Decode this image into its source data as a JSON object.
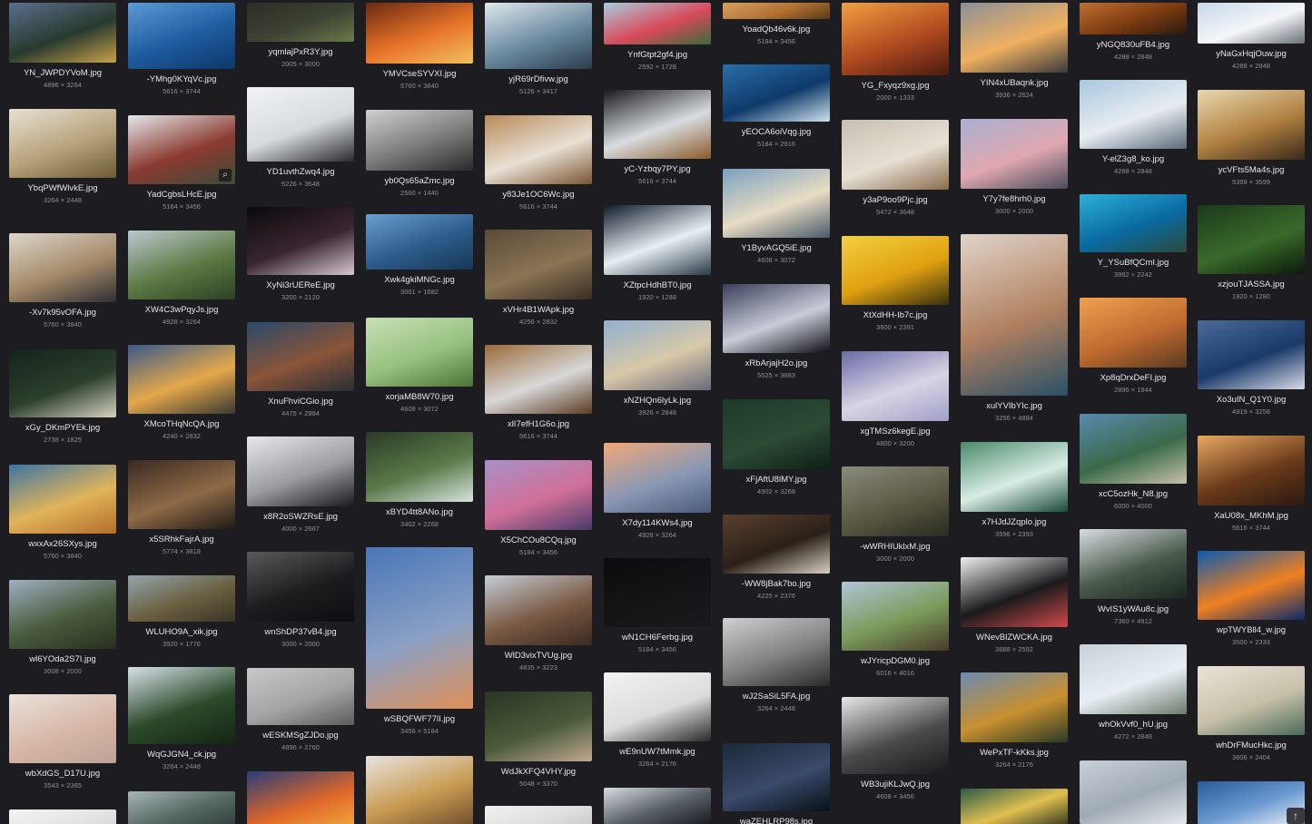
{
  "gallery": {
    "hovered_zoom_icon": "magnifier-icon",
    "scroll_top_icon": "arrow-up-icon",
    "columns": [
      [
        {
          "name": "YN_JWPDYVoM.jpg",
          "dims": "4896 × 3264",
          "colors": [
            "#5a6f8c",
            "#283a2e",
            "#c8a24a"
          ]
        },
        {
          "name": "YbqPWfWlvkE.jpg",
          "dims": "3264 × 2448",
          "colors": [
            "#e7e1d3",
            "#b6a27a",
            "#6b5a36"
          ]
        },
        {
          "name": "-Xv7k95vOFA.jpg",
          "dims": "5760 × 3840",
          "colors": [
            "#dcd6cc",
            "#a48a68",
            "#2e2e34"
          ]
        },
        {
          "name": "xGy_DKmPYEk.jpg",
          "dims": "2738 × 1825",
          "colors": [
            "#14231c",
            "#2c3f2c",
            "#d8d2c2"
          ]
        },
        {
          "name": "wxxAx26SXys.jpg",
          "dims": "5760 × 3840",
          "colors": [
            "#3f74a4",
            "#e0b45a",
            "#b36c2a"
          ]
        },
        {
          "name": "wl6YOda2S7I.jpg",
          "dims": "3008 × 2000",
          "colors": [
            "#9fb0c2",
            "#4a5a3c",
            "#283120"
          ]
        },
        {
          "name": "wbXdGS_D17U.jpg",
          "dims": "3543 × 2365",
          "colors": [
            "#e8e2dc",
            "#d7b7a6",
            "#bca296"
          ]
        },
        {
          "name": "",
          "dims": "",
          "colors": [
            "#f2f2f2",
            "#e4e4e4",
            "#d0d0d0"
          ]
        }
      ],
      [
        {
          "name": "-YMhg0KYqVc.jpg",
          "dims": "5616 × 3744",
          "colors": [
            "#5b9ad8",
            "#1e5b9e",
            "#0d3668"
          ]
        },
        {
          "name": "YadCgbsLHcE.jpg",
          "dims": "5184 × 3456",
          "colors": [
            "#e4e8ec",
            "#8b3a30",
            "#3c4c3a"
          ]
        },
        {
          "name": "XW4C3wPqyJs.jpg",
          "dims": "4928 × 3264",
          "colors": [
            "#bdc7cf",
            "#5c7a44",
            "#2d4024"
          ]
        },
        {
          "name": "XMcoTHqNcQA.jpg",
          "dims": "4240 × 2832",
          "colors": [
            "#395a8c",
            "#e5a84a",
            "#3a3834"
          ]
        },
        {
          "name": "x5SRhkFajrA.jpg",
          "dims": "5774 × 3818",
          "colors": [
            "#3a2a22",
            "#8e6a46",
            "#201a16"
          ]
        },
        {
          "name": "WLUHO9A_xik.jpg",
          "dims": "3920 × 1776",
          "colors": [
            "#93a4ac",
            "#6a6040",
            "#3a3426"
          ]
        },
        {
          "name": "WqGJGN4_ck.jpg",
          "dims": "3264 × 2448",
          "colors": [
            "#d8e2e8",
            "#2c4a2a",
            "#142414"
          ]
        },
        {
          "name": "",
          "dims": "",
          "colors": [
            "#a8b4b8",
            "#566a62",
            "#2e3c3a"
          ]
        }
      ],
      [
        {
          "name": "yqmlajPxR3Y.jpg",
          "dims": "2005 × 3000",
          "colors": [
            "#2b2d26",
            "#3e4434",
            "#6a7a4a"
          ]
        },
        {
          "name": "YD1uvthZwq4.jpg",
          "dims": "5226 × 3648",
          "colors": [
            "#f2f4f6",
            "#d6dade",
            "#2a2a2c"
          ]
        },
        {
          "name": "XyNi3rUEReE.jpg",
          "dims": "3200 × 2120",
          "colors": [
            "#0a0a0c",
            "#3a2630",
            "#d8c8d0"
          ]
        },
        {
          "name": "XnuFhviCGio.jpg",
          "dims": "4475 × 2984",
          "colors": [
            "#2a4a6a",
            "#8a5438",
            "#2a2e36"
          ]
        },
        {
          "name": "x8R2oSWZRsE.jpg",
          "dims": "4000 × 2667",
          "colors": [
            "#e8e8ea",
            "#9a9ca0",
            "#1a1a1c"
          ]
        },
        {
          "name": "wnShDP37vB4.jpg",
          "dims": "3000 × 2000",
          "colors": [
            "#5a5a5c",
            "#1c1c1e",
            "#0e0e10"
          ]
        },
        {
          "name": "wESKMSgZJDo.jpg",
          "dims": "4896 × 2760",
          "colors": [
            "#c8c8c8",
            "#a4a4a4",
            "#5c5c5c"
          ]
        },
        {
          "name": "",
          "dims": "",
          "colors": [
            "#2a3c78",
            "#e0682a",
            "#f2b440"
          ]
        }
      ],
      [
        {
          "name": "YMVCseSYVXI.jpg",
          "dims": "5760 × 3840",
          "colors": [
            "#6a2a10",
            "#e8742a",
            "#f0c060"
          ]
        },
        {
          "name": "yb0Qs65aZmc.jpg",
          "dims": "2560 × 1440",
          "colors": [
            "#d0d0d0",
            "#7a7a7a",
            "#2a2a2a"
          ]
        },
        {
          "name": "Xwk4gkiMNGc.jpg",
          "dims": "3061 × 1682",
          "colors": [
            "#6a9ed0",
            "#2c5c8a",
            "#1a3656"
          ]
        },
        {
          "name": "xorjaMB8W70.jpg",
          "dims": "4608 × 3072",
          "colors": [
            "#c8e0b4",
            "#96c080",
            "#4a7434"
          ]
        },
        {
          "name": "xBYD4tt8ANo.jpg",
          "dims": "3402 × 2268",
          "colors": [
            "#2a3a26",
            "#5a7a4a",
            "#d8e4e0"
          ]
        },
        {
          "name": "wSBQFWF77lI.jpg",
          "dims": "3456 × 5184",
          "colors": [
            "#4a76b8",
            "#8aa0c4",
            "#e09058"
          ]
        },
        {
          "name": "",
          "dims": "",
          "colors": [
            "#e8e4de",
            "#c89a52",
            "#6a4a2a"
          ]
        }
      ],
      [
        {
          "name": "yjR69rDfivw.jpg",
          "dims": "5126 × 3417",
          "colors": [
            "#dfe7ec",
            "#6a8aa0",
            "#2a3c4a"
          ]
        },
        {
          "name": "y83Je1OC6Wc.jpg",
          "dims": "5616 × 3744",
          "colors": [
            "#b88a5a",
            "#e8e0d4",
            "#7a5430"
          ]
        },
        {
          "name": "xVHr4B1WApk.jpg",
          "dims": "4256 × 2832",
          "colors": [
            "#5a4a3a",
            "#8a7454",
            "#3a2e24"
          ]
        },
        {
          "name": "xlI7efH1G6o.jpg",
          "dims": "5616 × 3744",
          "colors": [
            "#9a6a3a",
            "#d8d8d8",
            "#5a3c22"
          ]
        },
        {
          "name": "X5ChCOu8CQq.jpg",
          "dims": "5184 × 3456",
          "colors": [
            "#a890c8",
            "#d07098",
            "#4a3a6a"
          ]
        },
        {
          "name": "WlD3vixTVUg.jpg",
          "dims": "4835 × 3223",
          "colors": [
            "#c4ccd6",
            "#7a5a44",
            "#3a2a20"
          ]
        },
        {
          "name": "WdJkXFQ4VHY.jpg",
          "dims": "5048 × 3370",
          "colors": [
            "#2a3424",
            "#4a5a3a",
            "#c0a890"
          ]
        },
        {
          "name": "",
          "dims": "",
          "colors": [
            "#f0f0f0",
            "#e0e0e0",
            "#c8c8c8"
          ]
        }
      ],
      [
        {
          "name": "YnfGtpt2gf4.jpg",
          "dims": "2592 × 1728",
          "colors": [
            "#a8cce0",
            "#d84a5a",
            "#3a6a3a"
          ]
        },
        {
          "name": "yC-Yzbqy7PY.jpg",
          "dims": "5616 × 3744",
          "colors": [
            "#1a1a1c",
            "#d8dce0",
            "#8a5a2a"
          ]
        },
        {
          "name": "XZtpcHdhBT0.jpg",
          "dims": "1920 × 1288",
          "colors": [
            "#0e1a2a",
            "#e8eef2",
            "#2a3a48"
          ]
        },
        {
          "name": "xNZHQn6lyLk.jpg",
          "dims": "3926 × 2848",
          "colors": [
            "#90b0d0",
            "#d8c8a8",
            "#6a6a7a"
          ]
        },
        {
          "name": "X7dy114KWs4.jpg",
          "dims": "4928 × 3264",
          "colors": [
            "#f0a878",
            "#8a98b4",
            "#4a5a78"
          ]
        },
        {
          "name": "wN1CH6Ferbg.jpg",
          "dims": "5184 × 3456",
          "colors": [
            "#0c0c0e",
            "#141416",
            "#1a1a1c"
          ]
        },
        {
          "name": "wE9nUW7tMmk.jpg",
          "dims": "3264 × 2176",
          "colors": [
            "#f2f2f2",
            "#dcdcdc",
            "#2a2a2a"
          ]
        },
        {
          "name": "",
          "dims": "",
          "colors": [
            "#d8dce0",
            "#5a6068",
            "#1a1c20"
          ]
        }
      ],
      [
        {
          "name": "YoadQb46v6k.jpg",
          "dims": "5184 × 3456",
          "colors": [
            "#d8a060",
            "#b07030",
            "#5a3a1a"
          ]
        },
        {
          "name": "yEOCA6oiVqg.jpg",
          "dims": "5184 × 2916",
          "colors": [
            "#2a6ea8",
            "#0e3a6a",
            "#cfe0ec"
          ]
        },
        {
          "name": "Y1ByvAGQ5iE.jpg",
          "dims": "4608 × 3072",
          "colors": [
            "#7aa0c0",
            "#e8dcc4",
            "#4a5a6a"
          ]
        },
        {
          "name": "xRbArjajH2o.jpg",
          "dims": "5525 × 3683",
          "colors": [
            "#3a3e5a",
            "#c8ccd8",
            "#0e0e14"
          ]
        },
        {
          "name": "xFjAftU8lMY.jpg",
          "dims": "4902 × 3268",
          "colors": [
            "#1c3a2a",
            "#2c4a34",
            "#0e2018"
          ]
        },
        {
          "name": "-WW8jBak7bo.jpg",
          "dims": "4225 × 2376",
          "colors": [
            "#5a4030",
            "#2a2018",
            "#d8d0c4"
          ]
        },
        {
          "name": "wJ2SaSiL5FA.jpg",
          "dims": "3264 × 2448",
          "colors": [
            "#d0d0d0",
            "#808080",
            "#2a2a2a"
          ]
        },
        {
          "name": "waZEHLRP98s.jpg",
          "dims": "",
          "colors": [
            "#1a2a3a",
            "#3a4a6a",
            "#0a1018"
          ]
        }
      ],
      [
        {
          "name": "YG_Fxyqz9xg.jpg",
          "dims": "2000 × 1333",
          "colors": [
            "#f0a040",
            "#b04a20",
            "#4a1a10"
          ]
        },
        {
          "name": "y3aP9oo9Pjc.jpg",
          "dims": "5472 × 3648",
          "colors": [
            "#c8c0b0",
            "#e6e0d4",
            "#8a6a4a"
          ]
        },
        {
          "name": "XtXdHH-Ib7c.jpg",
          "dims": "3600 × 2391",
          "colors": [
            "#f0d040",
            "#e0a010",
            "#3a3010"
          ]
        },
        {
          "name": "xgTMSz6kegE.jpg",
          "dims": "4800 × 3200",
          "colors": [
            "#6a6aa8",
            "#d8d4e4",
            "#a0a0c8"
          ]
        },
        {
          "name": "-wWRHIUklxM.jpg",
          "dims": "3000 × 2000",
          "colors": [
            "#8a8a7a",
            "#5a5a44",
            "#2a2a20"
          ]
        },
        {
          "name": "wJYricpDGM0.jpg",
          "dims": "6016 × 4016",
          "colors": [
            "#b0c4d8",
            "#7a9a5a",
            "#4a3a2a"
          ]
        },
        {
          "name": "WB3ujiKLJwQ.jpg",
          "dims": "4608 × 3456",
          "colors": [
            "#e8e8e8",
            "#4a4a4c",
            "#1a1a1c"
          ]
        },
        {
          "name": "",
          "dims": "",
          "colors": [
            "#6a5a4a",
            "#8a7a6a",
            "#3a3a3a"
          ]
        }
      ],
      [
        {
          "name": "YIN4xUBaqnk.jpg",
          "dims": "3936 × 2624",
          "colors": [
            "#8a9098",
            "#f0b060",
            "#3a3a3c"
          ]
        },
        {
          "name": "Y7y7fe8hrh0.jpg",
          "dims": "3000 × 2000",
          "colors": [
            "#a8b0d0",
            "#e0a8b0",
            "#4a4a5a"
          ]
        },
        {
          "name": "xulYVIbYIc.jpg",
          "dims": "3256 × 4884",
          "colors": [
            "#e0d4c8",
            "#b08060",
            "#2a5068"
          ]
        },
        {
          "name": "x7HJdJZqplo.jpg",
          "dims": "3596 × 2393",
          "colors": [
            "#4a8a6a",
            "#d8ece4",
            "#1a4a3a"
          ]
        },
        {
          "name": "WNevBlZWCKA.jpg",
          "dims": "3888 × 2592",
          "colors": [
            "#f0f0f0",
            "#1a1a1c",
            "#d04a4a"
          ]
        },
        {
          "name": "WePxTF-kKks.jpg",
          "dims": "3264 × 2176",
          "colors": [
            "#6a8ab0",
            "#c89030",
            "#2a3a24"
          ]
        },
        {
          "name": "",
          "dims": "",
          "colors": [
            "#2a5a4a",
            "#e0c050",
            "#3a3a20"
          ]
        }
      ],
      [
        {
          "name": "yNGQ830uFB4.jpg",
          "dims": "4288 × 2848",
          "colors": [
            "#c07030",
            "#7a3a10",
            "#2a1810"
          ]
        },
        {
          "name": "Y-elZ3g8_ko.jpg",
          "dims": "4288 × 2848",
          "colors": [
            "#a8c8e0",
            "#e8ecf0",
            "#5a6a78"
          ]
        },
        {
          "name": "Y_YSuBfQCmI.jpg",
          "dims": "3992 × 2242",
          "colors": [
            "#2ab0d8",
            "#0a6aa0",
            "#2a4a3a"
          ]
        },
        {
          "name": "Xp8qDrxDeFI.jpg",
          "dims": "2896 × 1944",
          "colors": [
            "#f0a050",
            "#c06a30",
            "#5a3a20"
          ]
        },
        {
          "name": "xcC5ozHk_N8.jpg",
          "dims": "6000 × 4000",
          "colors": [
            "#5a8ab0",
            "#3a6a4a",
            "#c8c0a8"
          ]
        },
        {
          "name": "WvIS1yWAu8c.jpg",
          "dims": "7360 × 4912",
          "colors": [
            "#d8dce4",
            "#4a5a4a",
            "#1a2420"
          ]
        },
        {
          "name": "whOkVvf0_hU.jpg",
          "dims": "4272 × 2848",
          "colors": [
            "#c8d0d8",
            "#e8eef4",
            "#6a7a6a"
          ]
        },
        {
          "name": "",
          "dims": "",
          "colors": [
            "#c8d0d8",
            "#a0aab4",
            "#e4e8ec"
          ]
        }
      ],
      [
        {
          "name": "yNaGxHqjOuw.jpg",
          "dims": "4288 × 2848",
          "colors": [
            "#c8d8e8",
            "#f4f6f8",
            "#6a7078"
          ]
        },
        {
          "name": "ycVFts5Ma4s.jpg",
          "dims": "5399 × 3599",
          "colors": [
            "#e8d8b0",
            "#b08040",
            "#3a2a1a"
          ]
        },
        {
          "name": "xzjouTJASSA.jpg",
          "dims": "1920 × 1280",
          "colors": [
            "#1a3a1a",
            "#3a6a2a",
            "#0a1a0a"
          ]
        },
        {
          "name": "Xo3uIN_Q1Y0.jpg",
          "dims": "4919 × 3258",
          "colors": [
            "#4a6a98",
            "#1a3a6a",
            "#d8dce8"
          ]
        },
        {
          "name": "XaU08x_MKhM.jpg",
          "dims": "5616 × 3744",
          "colors": [
            "#e8a860",
            "#6a3a1a",
            "#2a1a10"
          ]
        },
        {
          "name": "wpTWYBll4_w.jpg",
          "dims": "3500 × 2333",
          "colors": [
            "#0a5ab0",
            "#f08020",
            "#0a2a6a"
          ]
        },
        {
          "name": "whDrFMucHkc.jpg",
          "dims": "3606 × 2404",
          "colors": [
            "#e8e4d8",
            "#c8c0a8",
            "#4a6a5a"
          ]
        },
        {
          "name": "",
          "dims": "",
          "colors": [
            "#2a5a9a",
            "#6a9ad0",
            "#e8ecf4"
          ]
        }
      ]
    ]
  }
}
